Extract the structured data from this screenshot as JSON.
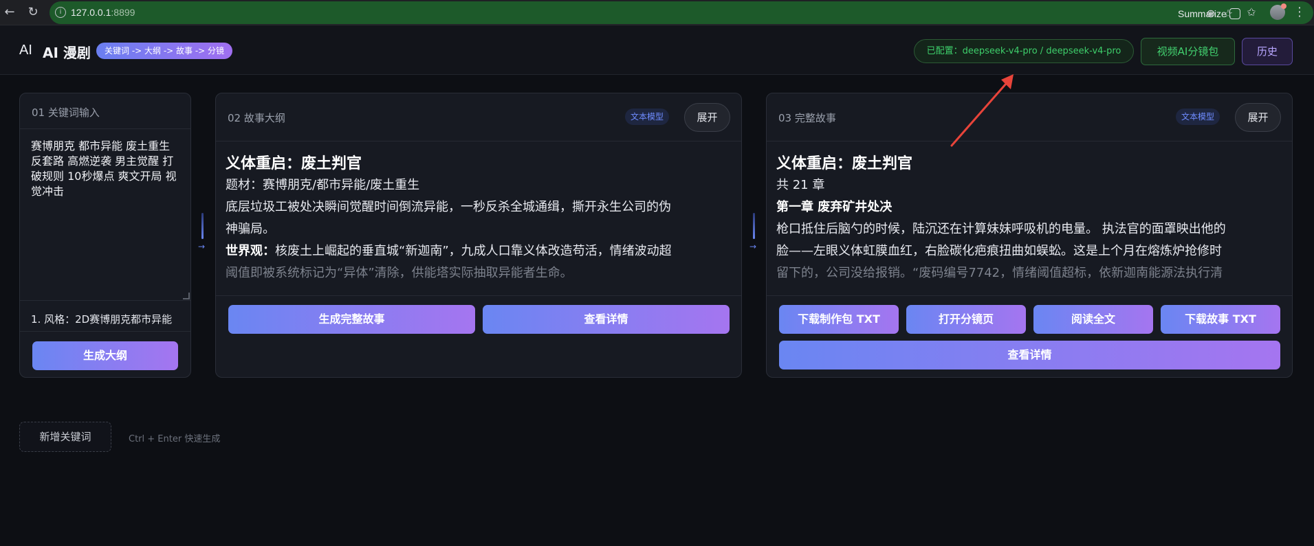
{
  "browser": {
    "url_host": "127.0.0.1",
    "url_port": ":8899",
    "summarize_label": "Summarize"
  },
  "header": {
    "brand_ai": "AI",
    "title": "AI 漫剧",
    "flow_badge": "关键词 -> 大纲 -> 故事 -> 分镜",
    "model_status": "已配置：deepseek-v4-pro / deepseek-v4-pro",
    "video_button": "视频AI分镜包",
    "history_button": "历史"
  },
  "keyword_card": {
    "title": "01 关键词输入",
    "keywords": "赛博朋克 都市异能 废土重生 反套路 高燃逆袭 男主觉醒 打破规则 10秒爆点 爽文开局 视觉冲击",
    "style": "1. 风格：2D赛博朋克都市异能",
    "generate_button": "生成大纲"
  },
  "outline_card": {
    "title": "02 故事大纲",
    "model_tag": "文本模型",
    "expand_button": "展开",
    "story_title": "义体重启：废土判官",
    "lines": [
      "题材：赛博朋克/都市异能/废土重生",
      "底层垃圾工被处决瞬间觉醒时间倒流异能，一秒反杀全城通缉，撕开永生公司的伪",
      "神骗局。"
    ],
    "worldview_label": "世界观：",
    "worldview_text": "核废土上崛起的垂直城“新迦南”，九成人口靠义体改造苟活，情绪波动超",
    "worldview_fade": "阈值即被系统标记为“异体”清除，供能塔实际抽取异能者生命。",
    "generate_story_button": "生成完整故事",
    "details_button": "查看详情"
  },
  "story_card": {
    "title": "03 完整故事",
    "model_tag": "文本模型",
    "expand_button": "展开",
    "story_title": "义体重启：废土判官",
    "chapters": "共 21 章",
    "chapter_heading": "第一章 废弃矿井处决",
    "lines": [
      "枪口抵住后脑勺的时候，陆沉还在计算妹妹呼吸机的电量。 执法官的面罩映出他的",
      "脸——左眼义体虹膜血红，右脸碳化疤痕扭曲如蜈蚣。这是上个月在熔炼炉抢修时"
    ],
    "fade_line": "留下的，公司没给报销。“废码编号7742，情绪阈值超标，依新迦南能源法执行清",
    "download_pack_button": "下载制作包 TXT",
    "open_storyboard_button": "打开分镜页",
    "read_full_button": "阅读全文",
    "download_story_button": "下载故事 TXT",
    "details_button": "查看详情"
  },
  "footer": {
    "new_keyword_button": "新增关键词",
    "shortcut_hint": "Ctrl + Enter 快速生成"
  },
  "colors": {
    "accent_gradient_start": "#6a86f2",
    "accent_gradient_end": "#a575f0",
    "status_green": "#3ecf6b",
    "history_purple": "#b8a6ff",
    "annotation_red": "#e8443a"
  }
}
